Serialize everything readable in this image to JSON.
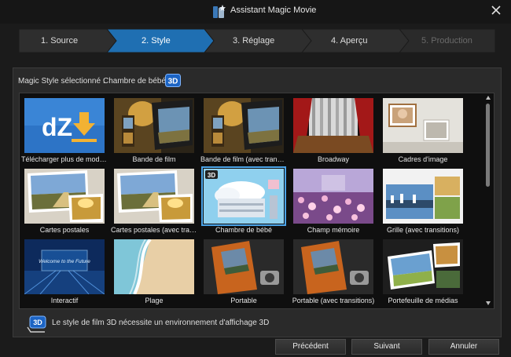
{
  "window": {
    "title": "Assistant Magic Movie",
    "icon": "magic-wand-icon",
    "close_icon": "close-icon"
  },
  "steps": [
    {
      "label": "1. Source",
      "state": "done"
    },
    {
      "label": "2. Style",
      "state": "active"
    },
    {
      "label": "3. Réglage",
      "state": "pending"
    },
    {
      "label": "4. Aperçu",
      "state": "pending"
    },
    {
      "label": "5. Production",
      "state": "disabled"
    }
  ],
  "selected_style": {
    "label": "Magic Style sélectionné :",
    "value": "Chambre de bébé",
    "badge": "3D"
  },
  "styles": [
    {
      "label": "Télécharger plus de modèles",
      "art": "dz"
    },
    {
      "label": "Bande de film",
      "art": "film"
    },
    {
      "label": "Bande de film (avec transitions)",
      "art": "film"
    },
    {
      "label": "Broadway",
      "art": "broadway"
    },
    {
      "label": "Cadres d'image",
      "art": "frames"
    },
    {
      "label": "Cartes postales",
      "art": "postcard"
    },
    {
      "label": "Cartes postales (avec transitions)",
      "art": "postcard"
    },
    {
      "label": "Chambre de bébé",
      "art": "baby",
      "selected": true,
      "badge": "3D"
    },
    {
      "label": "Champ mémoire",
      "art": "memory"
    },
    {
      "label": "Grille (avec transitions)",
      "art": "grid"
    },
    {
      "label": "Interactif",
      "art": "interactive",
      "overlay": "Welcome to the Future"
    },
    {
      "label": "Plage",
      "art": "beach"
    },
    {
      "label": "Portable",
      "art": "notebook"
    },
    {
      "label": "Portable (avec transitions)",
      "art": "notebook"
    },
    {
      "label": "Portefeuille de médias",
      "art": "portfolio"
    }
  ],
  "note": {
    "text": "Le style de film 3D nécessite un environnement d'affichage 3D",
    "badge": "3D",
    "icon": "3d-glasses-icon"
  },
  "buttons": {
    "previous": "Précédent",
    "next": "Suivant",
    "cancel": "Annuler"
  },
  "colors": {
    "accent": "#1f6fb2",
    "selection": "#4aa3e8",
    "background": "#1b1b1b"
  }
}
